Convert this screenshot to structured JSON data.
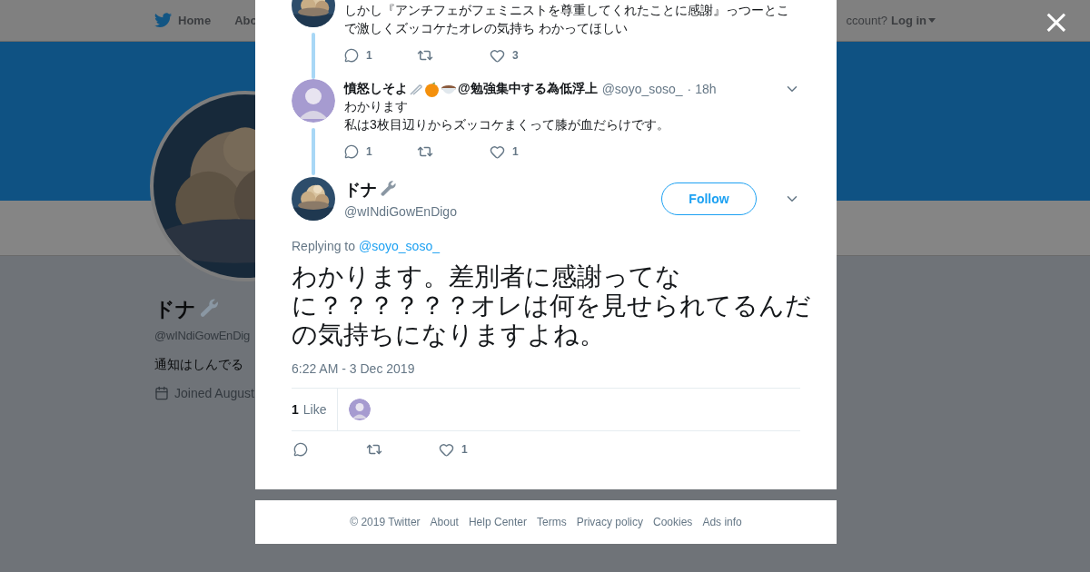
{
  "background_page": {
    "nav": {
      "items": [
        "Home",
        "Abo"
      ],
      "account_prompt": "ccount?",
      "login": "Log in"
    },
    "profile": {
      "name": "ドナ",
      "handle": "@wINdiGowEnDig",
      "bio": "通知はしんでる",
      "joined": "Joined August"
    }
  },
  "modal": {
    "thread": [
      {
        "lines": [
          "しかし『アンチフェがフェミニストを尊重してくれたことに感謝』っつーとこ",
          "で激しくズッコケたオレの気持ち わかってほしい"
        ],
        "actions": {
          "replies": "1",
          "likes": "3"
        }
      },
      {
        "name": "憤怒しそよ",
        "name_suffix": "@勉強集中する為低浮上",
        "handle": "@soyo_soso_",
        "time": "· 18h",
        "lines": [
          "わかります",
          "私は3枚目辺りからズッコケまくって膝が血だらけです。"
        ],
        "actions": {
          "replies": "1",
          "likes": "1"
        }
      }
    ],
    "main_tweet": {
      "name": "ドナ",
      "handle": "@wINdiGowEnDigo",
      "follow": "Follow",
      "replying_label": "Replying to",
      "replying_to": "@soyo_soso_",
      "text": "わかります。差別者に感謝ってなに？？？？？？オレは何を見せられてるんだの気持ちになりますよね。",
      "timestamp": "6:22 AM - 3 Dec 2019",
      "like_count": "1",
      "like_label": "Like",
      "actions": {
        "likes": "1"
      }
    }
  },
  "close": "×",
  "footer": {
    "links": [
      "© 2019 Twitter",
      "About",
      "Help Center",
      "Terms",
      "Privacy policy",
      "Cookies",
      "Ads info"
    ]
  }
}
